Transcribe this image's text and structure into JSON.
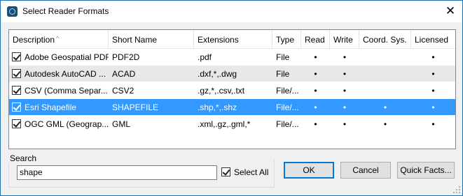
{
  "window": {
    "title": "Select Reader Formats"
  },
  "table": {
    "columns": [
      "Description",
      "Short Name",
      "Extensions",
      "Type",
      "Read",
      "Write",
      "Coord. Sys.",
      "Licensed"
    ],
    "rows": [
      {
        "description": "Adobe Geospatial PDF",
        "short_name": "PDF2D",
        "extensions": ".pdf",
        "type": "File",
        "read": "•",
        "write": "•",
        "coord": "",
        "licensed": "•",
        "checked": true
      },
      {
        "description": "Autodesk AutoCAD ...",
        "short_name": "ACAD",
        "extensions": ".dxf,*,.dwg",
        "type": "File",
        "read": "•",
        "write": "•",
        "coord": "",
        "licensed": "•",
        "checked": true
      },
      {
        "description": "CSV (Comma Separ...",
        "short_name": "CSV2",
        "extensions": ".gz,*,.csv,.txt",
        "type": "File/...",
        "read": "•",
        "write": "•",
        "coord": "",
        "licensed": "•",
        "checked": true
      },
      {
        "description": "Esri Shapefile",
        "short_name": "SHAPEFILE",
        "extensions": ".shp,*,.shz",
        "type": "File/...",
        "read": "•",
        "write": "•",
        "coord": "•",
        "licensed": "•",
        "checked": true
      },
      {
        "description": "OGC GML (Geograp...",
        "short_name": "GML",
        "extensions": ".xml,.gz,.gml,*",
        "type": "File/...",
        "read": "•",
        "write": "•",
        "coord": "•",
        "licensed": "•",
        "checked": true
      }
    ],
    "selected_row": 3
  },
  "search": {
    "label": "Search",
    "value": "shape",
    "select_all_label": "Select All",
    "select_all_checked": true
  },
  "buttons": {
    "ok": "OK",
    "cancel": "Cancel",
    "quick_facts": "Quick Facts..."
  },
  "colors": {
    "selection": "#3399ff",
    "alt_row": "#e8e8e8",
    "default_button_border": "#0078d7"
  }
}
